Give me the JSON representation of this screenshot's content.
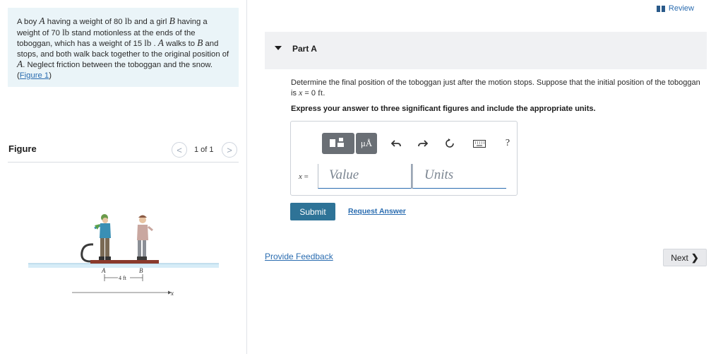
{
  "header": {
    "review_label": "Review"
  },
  "problem": {
    "t1": "A boy ",
    "var_a": "A",
    "t2": " having a weight of 80 ",
    "unit_lb": "lb",
    "t3": " and a girl ",
    "var_b": "B",
    "t4": " having a weight of 70 ",
    "t5": " stand motionless at the ends of the toboggan, which has a weight of 15 ",
    "t6": " . ",
    "t7": " walks to ",
    "t8": " and stops, and both walk back together to the original position of ",
    "t9": ". Neglect friction between the toboggan and the snow. (",
    "figure_link": "Figure 1",
    "t10": ")"
  },
  "figure": {
    "title": "Figure",
    "prev_label": "<",
    "next_label": ">",
    "count": "1 of 1",
    "label_a": "A",
    "label_b": "B",
    "dimension": "4 ft",
    "axis_label": "x"
  },
  "part": {
    "title": "Part A"
  },
  "question": {
    "q1": "Determine the final position of the toboggan just after the motion stops. Suppose that the initial position of the toboggan is ",
    "var_x": "x",
    "q2": " = 0 ",
    "unit_ft": "ft",
    "q3": ".",
    "instructions": "Express your answer to three significant figures and include the appropriate units."
  },
  "answer": {
    "mu_label": "μÅ",
    "help_label": "?",
    "eq_var": "x",
    "eq_sign": " =",
    "value_placeholder": "Value",
    "units_placeholder": "Units"
  },
  "actions": {
    "submit_label": "Submit",
    "request_label": "Request Answer",
    "feedback_label": "Provide Feedback",
    "next_label": "Next"
  }
}
